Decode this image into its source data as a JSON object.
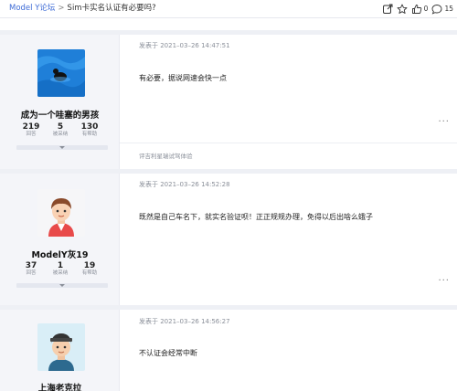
{
  "breadcrumb": {
    "forum": "Model Y论坛",
    "separator": ">",
    "current": "Sim卡实名认证有必要吗?"
  },
  "toolbar": {
    "like_count": "0",
    "comment_count": "15"
  },
  "posts": [
    {
      "username": "成为一个哇塞的男孩",
      "stats": [
        {
          "value": "219",
          "label": "回答"
        },
        {
          "value": "5",
          "label": "被采纳"
        },
        {
          "value": "130",
          "label": "有帮助"
        }
      ],
      "meta": "发表于 2021–03–26 14:47:51",
      "content": "有必要，据说网速会快一点",
      "more": "···",
      "review": "评吉利星瑞试驾体验"
    },
    {
      "username": "ModelY灰19",
      "stats": [
        {
          "value": "37",
          "label": "回答"
        },
        {
          "value": "1",
          "label": "被采纳"
        },
        {
          "value": "19",
          "label": "有帮助"
        }
      ],
      "meta": "发表于 2021–03–26 14:52:28",
      "content": "既然是自己车名下，就实名验证呗！正正规规办理，免得以后出啥么蛾子",
      "more": "···"
    },
    {
      "username": "上海老克拉",
      "meta": "发表于 2021–03–26 14:56:27",
      "content": "不认证会经常中断"
    }
  ],
  "colors": {
    "link": "#3e6bd6",
    "sidebar_bg": "#f4f5f9",
    "divider": "#eef0f5"
  }
}
